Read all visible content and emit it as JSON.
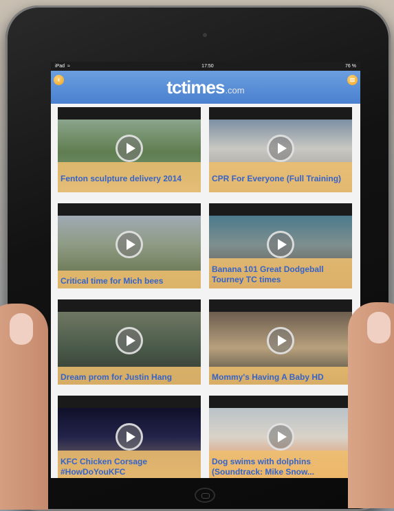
{
  "status_bar": {
    "carrier": "iPad",
    "wifi": "wifi-icon",
    "time": "17:50",
    "battery": "76 %"
  },
  "header": {
    "logo_main": "tctimes",
    "logo_suffix": ".com",
    "back_button": "back-icon",
    "menu_button": "menu-icon",
    "colors": {
      "header_blue": "#4a80cf",
      "button_orange": "#f0a21e",
      "caption_bg": "#eebe6e",
      "caption_text": "#3563c8"
    }
  },
  "videos": [
    {
      "title": "Fenton sculpture delivery 2014"
    },
    {
      "title": "CPR For Everyone (Full Training)"
    },
    {
      "title": "Critical time for Mich bees"
    },
    {
      "title": "Banana 101 Great Dodgeball Tourney TC times"
    },
    {
      "title": "Dream prom for Justin Hang"
    },
    {
      "title": "Mommy's Having A Baby HD"
    },
    {
      "title": "KFC Chicken Corsage #HowDoYouKFC"
    },
    {
      "title": "Dog swims with dolphins (Soundtrack: Mike Snow..."
    }
  ]
}
